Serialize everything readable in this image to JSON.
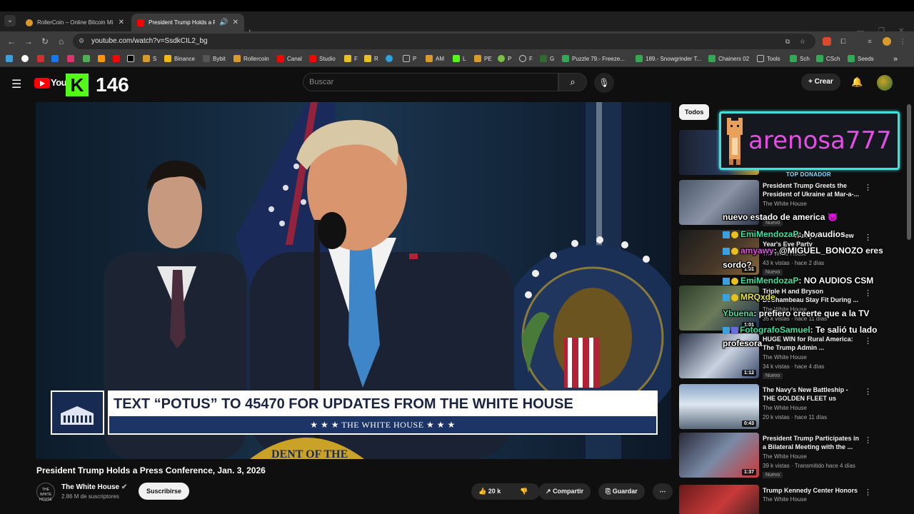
{
  "browser": {
    "tabs": [
      {
        "title": "RollerCoin – Online Bitcoin Mi",
        "color": "#d99a2b"
      },
      {
        "title": "President Trump Holds a Pr",
        "color": "#ff0000"
      }
    ],
    "url": "youtube.com/watch?v=SsdkCIL2_bg",
    "bookmarks": [
      {
        "label": "S",
        "color": "#d99a2b"
      },
      {
        "label": "Binance",
        "color": "#f0b90b"
      },
      {
        "label": "Bybit",
        "color": "#333333"
      },
      {
        "label": "Rollercoin",
        "color": "#d99a2b"
      },
      {
        "label": "Canal",
        "color": "#ff0000"
      },
      {
        "label": "Studio",
        "color": "#ff0000"
      },
      {
        "label": "F",
        "color": "#e8c020"
      },
      {
        "label": "R",
        "color": "#e8c020"
      },
      {
        "label": "P",
        "color": "#888888"
      },
      {
        "label": "AM",
        "color": "#d99a2b"
      },
      {
        "label": "L",
        "color": "#53fc18"
      },
      {
        "label": "PE",
        "color": "#d99a2b"
      },
      {
        "label": "P",
        "color": "#7cc242"
      },
      {
        "label": "F",
        "color": "#cccccc"
      },
      {
        "label": "G",
        "color": "#2f6a2f"
      },
      {
        "label": "Puzzle 79.- Freeze...",
        "color": "#34a853"
      },
      {
        "label": "189.- Snowgrinder T...",
        "color": "#34a853"
      },
      {
        "label": "Chainers 02",
        "color": "#34a853"
      },
      {
        "label": "Tools",
        "color": "#888888"
      },
      {
        "label": "Sch",
        "color": "#34a853"
      },
      {
        "label": "CSch",
        "color": "#34a853"
      },
      {
        "label": "Seeds",
        "color": "#34a853"
      }
    ]
  },
  "youtube": {
    "logo_text": "YouT",
    "search_placeholder": "Buscar",
    "create_label": "+ Crear"
  },
  "kick_overlay": {
    "logo": "K",
    "viewer_count": "146"
  },
  "video": {
    "lower_third_headline": "TEXT “POTUS” TO 45470 FOR UPDATES FROM THE WHITE HOUSE",
    "lower_third_brand": "★ ★ ★   THE WHITE HOUSE   ★ ★ ★",
    "title": "President Trump Holds a Press Conference, Jan. 3, 2026",
    "channel": "The White House",
    "channel_avatar_text": "THE WHITE HOUSE",
    "subscribers": "2.86 M de suscriptores",
    "subscribe_label": "Suscribirse",
    "likes": "20 k",
    "share_label": "Compartir",
    "save_label": "Guardar"
  },
  "sidebar": {
    "chip": "Todos",
    "recommendations": [
      {
        "title": "President Trump Greets the President of Ukraine at Mar-a-...",
        "channel": "The White House",
        "meta": "30 k vistas · hace 8 días",
        "duration": "",
        "badge": "Nuevo"
      },
      {
        "title": "President Trump Attends New Year's Eve Party",
        "channel": "The White House",
        "meta": "43 k vistas · hace 2 días",
        "duration": "1:01",
        "badge": "Nuevo"
      },
      {
        "title": "Triple H and Bryson DeChambeau Stay Fit During ...",
        "channel": "The White House",
        "meta": "35 k vistas · hace 11 días",
        "duration": "1:01",
        "badge": ""
      },
      {
        "title": "HUGE WIN for Rural America: The Trump Admin ...",
        "channel": "The White House",
        "meta": "34 k vistas · hace 4 días",
        "duration": "1:12",
        "badge": "Nuevo"
      },
      {
        "title": "The Navy's New Battleship - THE GOLDEN FLEET us",
        "channel": "The White House",
        "meta": "20 k vistas · hace 11 días",
        "duration": "0:43",
        "badge": ""
      },
      {
        "title": "President Trump Participates in a Bilateral Meeting with the ...",
        "channel": "The White House",
        "meta": "39 k vistas · Transmitido hace 4 días",
        "duration": "1:37",
        "badge": "Nuevo"
      },
      {
        "title": "Trump Kennedy Center Honors",
        "channel": "The White House",
        "meta": "",
        "duration": "",
        "badge": ""
      }
    ]
  },
  "stream_overlay": {
    "top_donor_name": "arenosa777",
    "top_donor_label": "TOP DONADOR",
    "chat": [
      {
        "user": "",
        "text": "nuevo estado de america"
      },
      {
        "user": "EmiMendozaP",
        "text": ": No audios"
      },
      {
        "user": "amyawy",
        "text": ": @MIGUEL_BONOZO eres"
      },
      {
        "user": "",
        "text": "sordo?"
      },
      {
        "user": "EmiMendozaP",
        "text": ": NO AUDIOS CSM"
      },
      {
        "user": "MRQxde",
        "text": ""
      },
      {
        "user": "Ybuena",
        "text": ": prefiero creerte que a la TV"
      },
      {
        "user": "FotografoSamuel",
        "text": ": Te salió tu lado"
      },
      {
        "user": "",
        "text": "profesora"
      }
    ]
  },
  "colors": {
    "yt_red": "#ff0000",
    "kick_green": "#53fc18",
    "overlay_cyan": "#3fe0e0",
    "overlay_magenta": "#e64de6",
    "whitehouse_navy": "#1c3466"
  }
}
